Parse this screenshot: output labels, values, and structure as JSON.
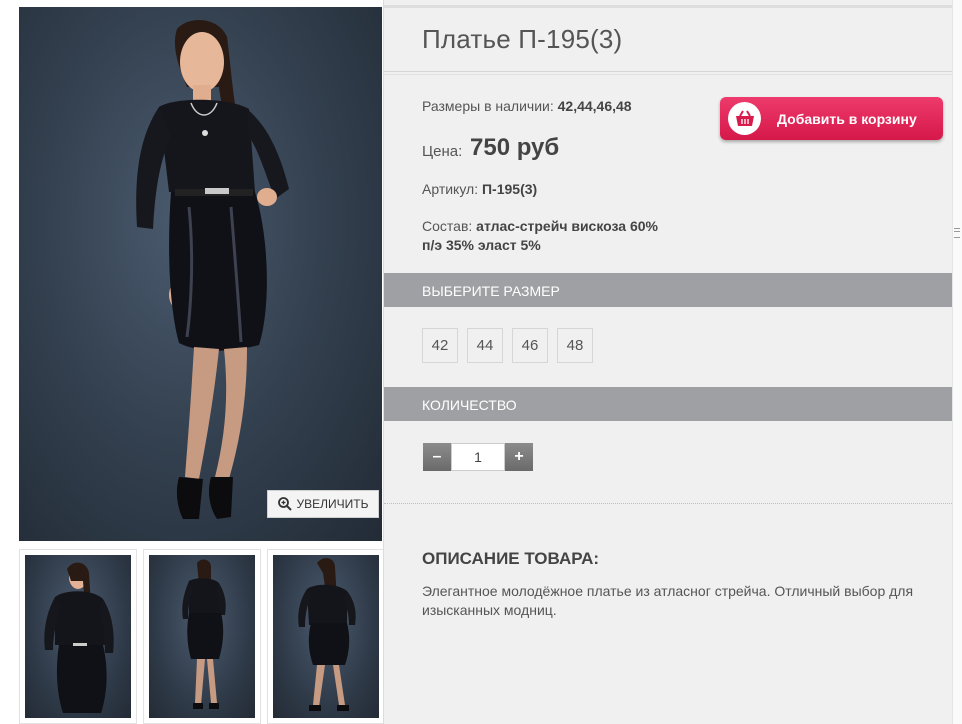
{
  "product": {
    "title": "Платье П-195(3)",
    "sizes_label": "Размеры в наличии:",
    "sizes_value": "42,44,46,48",
    "price_label": "Цена:",
    "price_value": "750 руб",
    "sku_label": "Артикул:",
    "sku_value": "П-195(3)",
    "composition_label": "Состав:",
    "composition_value_1": "атлас-стрейч вискоза 60%",
    "composition_value_2": "п/э 35% эласт 5%"
  },
  "gallery": {
    "zoom_label": "УВЕЛИЧИТЬ"
  },
  "cart": {
    "add_label": "Добавить в корзину"
  },
  "size_section": {
    "title": "ВЫБЕРИТЕ РАЗМЕР",
    "options": [
      "42",
      "44",
      "46",
      "48"
    ]
  },
  "quantity_section": {
    "title": "КОЛИЧЕСТВО",
    "minus": "–",
    "value": "1",
    "plus": "+"
  },
  "description": {
    "title": "ОПИСАНИЕ ТОВАРА:",
    "text": "Элегантное молодёжное платье из атласног стрейча. Отличный выбор для изысканных модниц."
  },
  "colors": {
    "accent": "#e02256",
    "section_bar": "#9ea0a3",
    "panel_bg": "#f0f0f0"
  }
}
